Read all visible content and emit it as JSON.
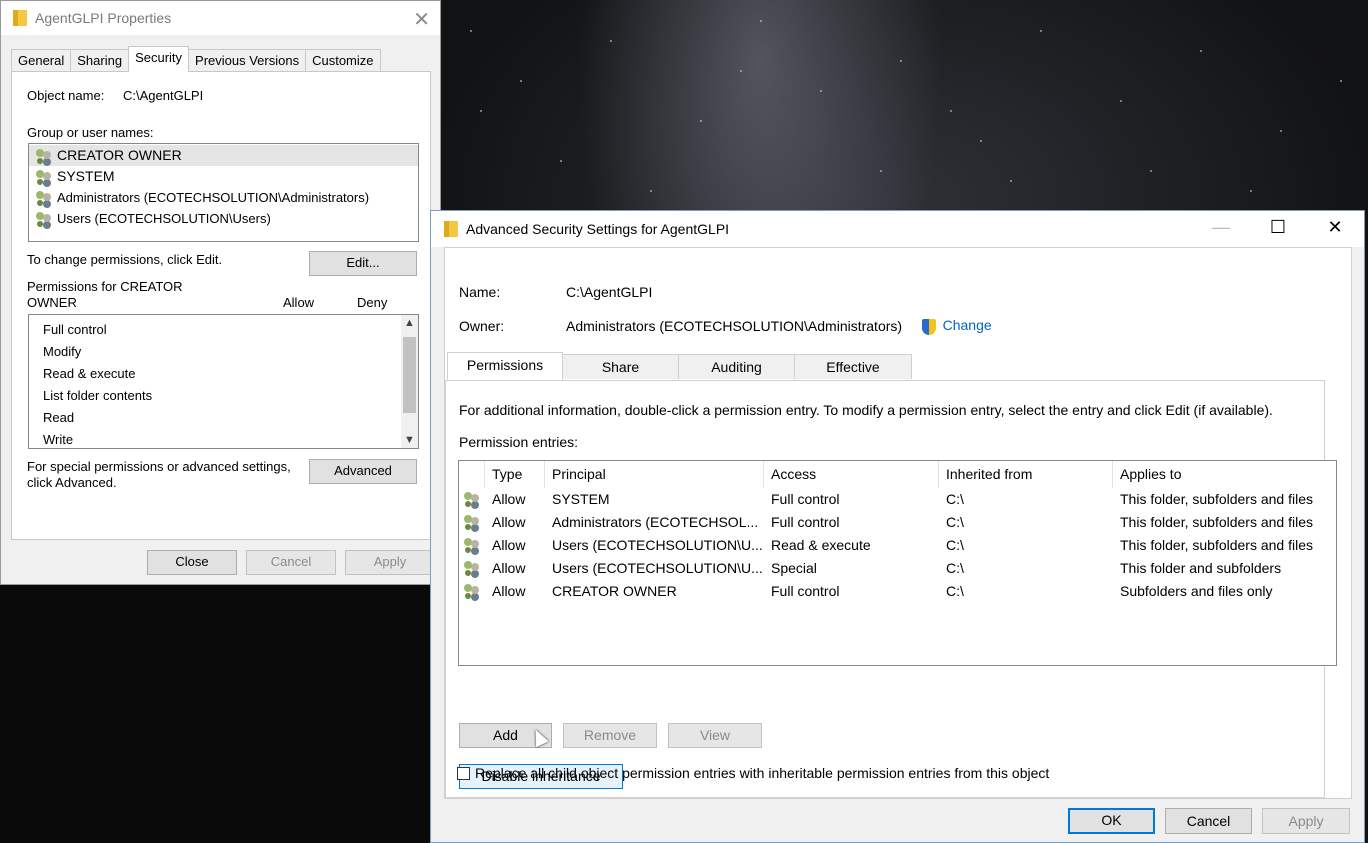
{
  "properties_window": {
    "title": "AgentGLPI Properties",
    "tabs": [
      "General",
      "Sharing",
      "Security",
      "Previous Versions",
      "Customize"
    ],
    "active_tab": "Security",
    "object_name_label": "Object name:",
    "object_name_value": "C:\\AgentGLPI",
    "group_label": "Group or user names:",
    "users": [
      "CREATOR OWNER",
      "SYSTEM",
      "Administrators (ECOTECHSOLUTION\\Administrators)",
      "Users (ECOTECHSOLUTION\\Users)"
    ],
    "selected_user": "CREATOR OWNER",
    "change_perm_text": "To change permissions, click Edit.",
    "edit_button": "Edit...",
    "permissions_for_line1": "Permissions for CREATOR",
    "permissions_for_line2": "OWNER",
    "allow_col": "Allow",
    "deny_col": "Deny",
    "permissions": [
      "Full control",
      "Modify",
      "Read & execute",
      "List folder contents",
      "Read",
      "Write"
    ],
    "special_text_line1": "For special permissions or advanced settings,",
    "special_text_line2": "click Advanced.",
    "advanced_button": "Advanced",
    "close_button": "Close",
    "cancel_button": "Cancel",
    "apply_button": "Apply"
  },
  "advanced_window": {
    "title": "Advanced Security Settings for AgentGLPI",
    "name_label": "Name:",
    "name_value": "C:\\AgentGLPI",
    "owner_label": "Owner:",
    "owner_value": "Administrators (ECOTECHSOLUTION\\Administrators)",
    "change_link": "Change",
    "tabs": [
      "Permissions",
      "Share",
      "Auditing",
      "Effective Access"
    ],
    "active_tab": "Permissions",
    "info_text": "For additional information, double-click a permission entry. To modify a permission entry, select the entry and click Edit (if available).",
    "entries_label": "Permission entries:",
    "columns": [
      "Type",
      "Principal",
      "Access",
      "Inherited from",
      "Applies to"
    ],
    "entries": [
      {
        "type": "Allow",
        "principal": "SYSTEM",
        "access": "Full control",
        "inherited": "C:\\",
        "applies": "This folder, subfolders and files"
      },
      {
        "type": "Allow",
        "principal": "Administrators (ECOTECHSOL...",
        "access": "Full control",
        "inherited": "C:\\",
        "applies": "This folder, subfolders and files"
      },
      {
        "type": "Allow",
        "principal": "Users (ECOTECHSOLUTION\\U...",
        "access": "Read & execute",
        "inherited": "C:\\",
        "applies": "This folder, subfolders and files"
      },
      {
        "type": "Allow",
        "principal": "Users (ECOTECHSOLUTION\\U...",
        "access": "Special",
        "inherited": "C:\\",
        "applies": "This folder and subfolders"
      },
      {
        "type": "Allow",
        "principal": "CREATOR OWNER",
        "access": "Full control",
        "inherited": "C:\\",
        "applies": "Subfolders and files only"
      }
    ],
    "add_button": "Add",
    "remove_button": "Remove",
    "view_button": "View",
    "disable_inheritance_button": "Disable inheritance",
    "replace_checkbox_label": "Replace all child object permission entries with inheritable permission entries from this object",
    "replace_checked": false,
    "ok_button": "OK",
    "cancel_button": "Cancel",
    "apply_button": "Apply",
    "minimize_glyph": "—",
    "maximize_glyph": "☐",
    "close_glyph": "✕"
  },
  "colors": {
    "accent": "#0078d7",
    "link": "#0066cc",
    "selected_row": "#e5e5e5",
    "focus_button": "#e5f1fb"
  }
}
